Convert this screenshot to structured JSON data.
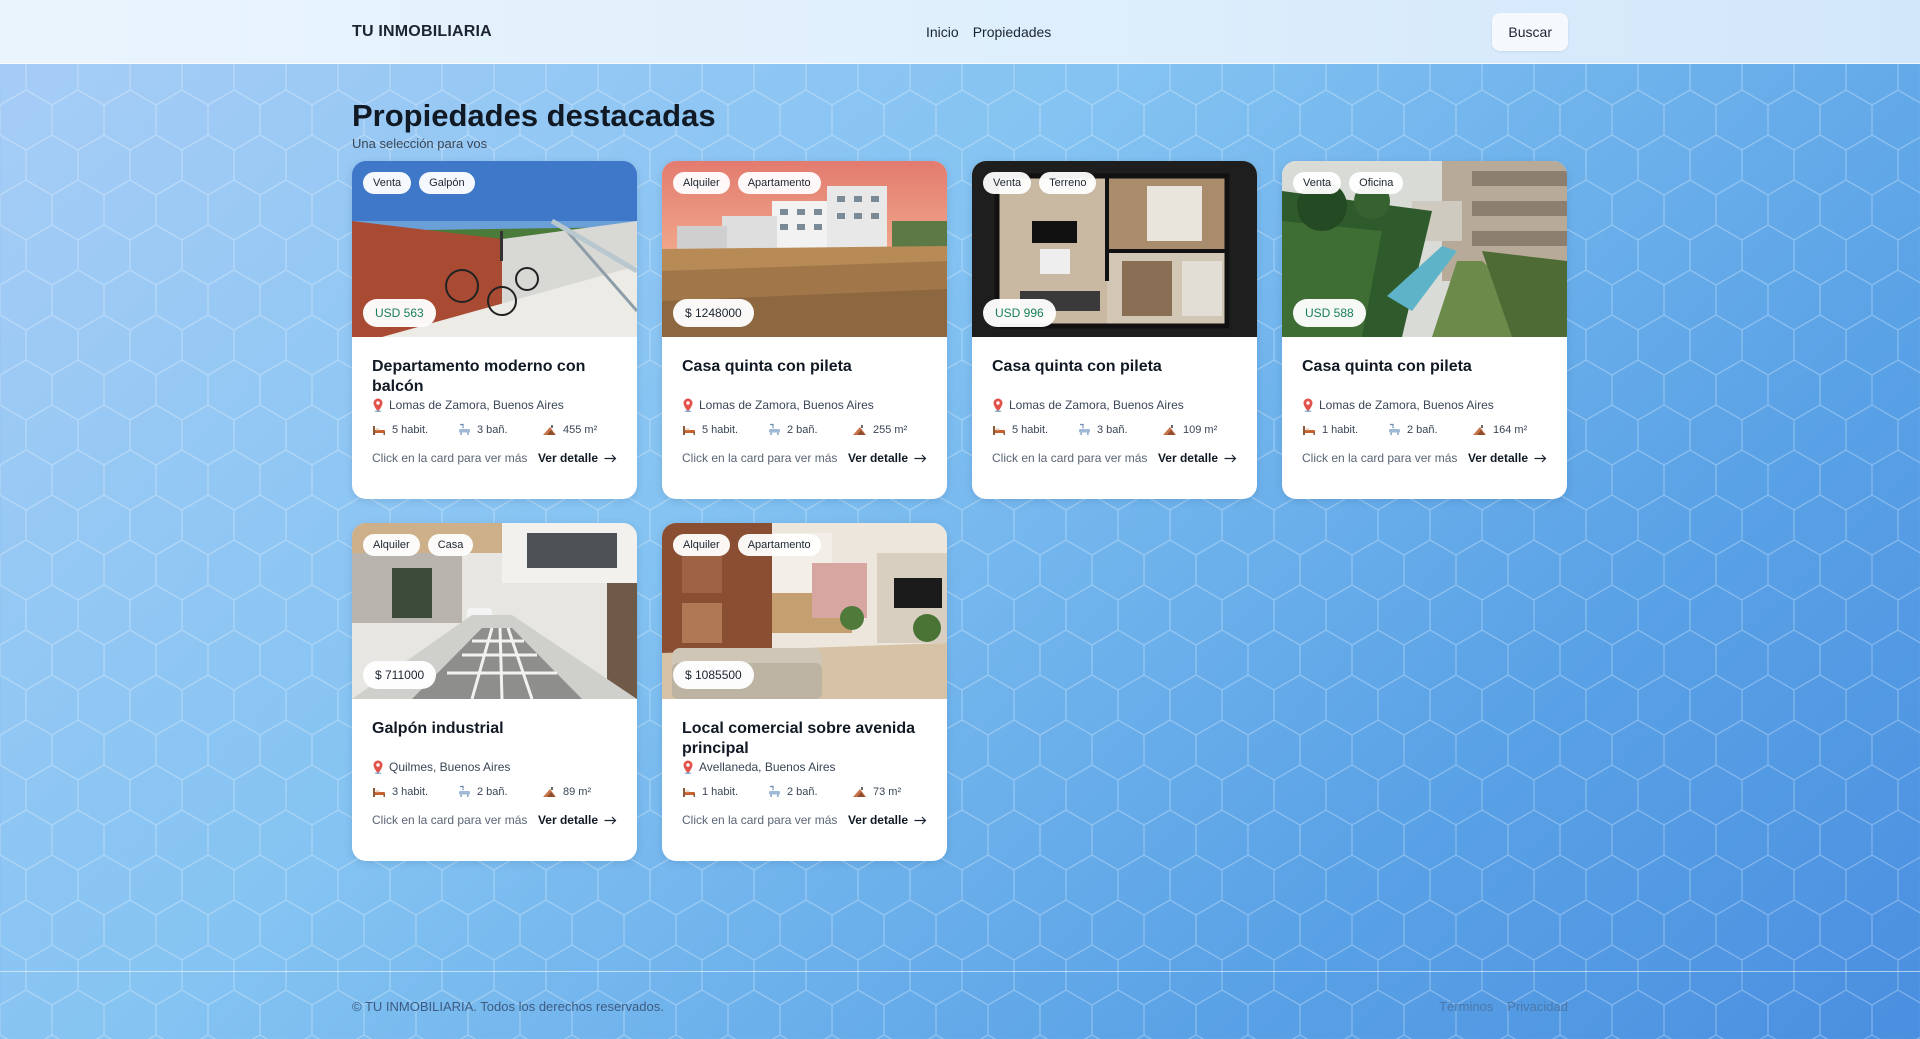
{
  "nav": {
    "brand": "TU INMOBILIARIA",
    "links": [
      "Inicio",
      "Propiedades"
    ],
    "search_label": "Buscar"
  },
  "section": {
    "title": "Propiedades destacadas",
    "subtitle": "Una selección para vos"
  },
  "cards": [
    {
      "tags": [
        "Venta",
        "Galpón"
      ],
      "price": "USD 563",
      "title": "Departamento moderno con balcón",
      "location": "Lomas de Zamora, Buenos Aires",
      "rooms": "5 habit.",
      "baths": "3 bañ.",
      "area": "455 m²",
      "hint": "Click en la card para ver más",
      "detail": "Ver detalle"
    },
    {
      "tags": [
        "Alquiler",
        "Apartamento"
      ],
      "price": "$ 1248000",
      "title": "Casa quinta con pileta",
      "location": "Lomas de Zamora, Buenos Aires",
      "rooms": "5 habit.",
      "baths": "2 bañ.",
      "area": "255 m²",
      "hint": "Click en la card para ver más",
      "detail": "Ver detalle"
    },
    {
      "tags": [
        "Venta",
        "Terreno"
      ],
      "price": "USD 996",
      "title": "Casa quinta con pileta",
      "location": "Lomas de Zamora, Buenos Aires",
      "rooms": "5 habit.",
      "baths": "3 bañ.",
      "area": "109 m²",
      "hint": "Click en la card para ver más",
      "detail": "Ver detalle"
    },
    {
      "tags": [
        "Venta",
        "Oficina"
      ],
      "price": "USD 588",
      "title": "Casa quinta con pileta",
      "location": "Lomas de Zamora, Buenos Aires",
      "rooms": "1 habit.",
      "baths": "2 bañ.",
      "area": "164 m²",
      "hint": "Click en la card para ver más",
      "detail": "Ver detalle"
    },
    {
      "tags": [
        "Alquiler",
        "Casa"
      ],
      "price": "$ 711000",
      "title": "Galpón industrial",
      "location": "Quilmes, Buenos Aires",
      "rooms": "3 habit.",
      "baths": "2 bañ.",
      "area": "89 m²",
      "hint": "Click en la card para ver más",
      "detail": "Ver detalle"
    },
    {
      "tags": [
        "Alquiler",
        "Apartamento"
      ],
      "price": "$ 1085500",
      "title": "Local comercial sobre avenida principal",
      "location": "Avellaneda, Buenos Aires",
      "rooms": "1 habit.",
      "baths": "2 bañ.",
      "area": "73 m²",
      "hint": "Click en la card para ver más",
      "detail": "Ver detalle"
    }
  ],
  "footer": {
    "copyright": "© TU INMOBILIARIA. Todos los derechos reservados.",
    "links": [
      "Términos",
      "Privacidad"
    ]
  },
  "colors": {
    "usd_price": "#178055",
    "accent_bg": "#5aa2e6"
  },
  "icons": {
    "location": "map-pin-icon",
    "rooms": "bed-icon",
    "baths": "bath-icon",
    "area": "area-icon",
    "detail": "arrow-right-icon"
  }
}
